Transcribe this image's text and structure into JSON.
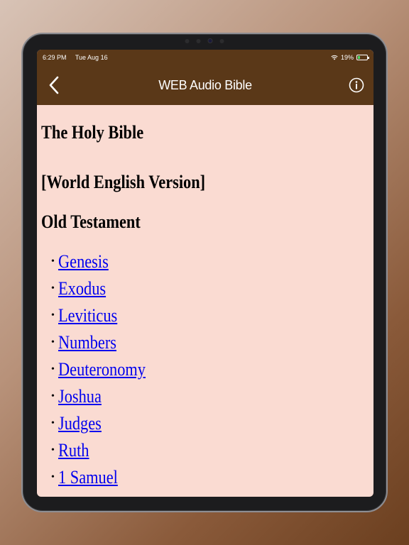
{
  "status_bar": {
    "time": "6:29 PM",
    "date": "Tue Aug 16",
    "battery": "19%"
  },
  "nav": {
    "title": "WEB Audio Bible",
    "back_icon": "chevron-left-icon",
    "info_icon": "info-circle-icon"
  },
  "content": {
    "title": "The Holy Bible",
    "version": "[World English Version]",
    "testament": "Old Testament",
    "books": [
      "Genesis",
      "Exodus",
      "Leviticus",
      "Numbers",
      "Deuteronomy",
      "Joshua",
      "Judges",
      "Ruth",
      "1 Samuel"
    ]
  },
  "colors": {
    "bar_bg": "#5a3818",
    "page_bg": "#fadbd2",
    "link": "#0000ee"
  }
}
